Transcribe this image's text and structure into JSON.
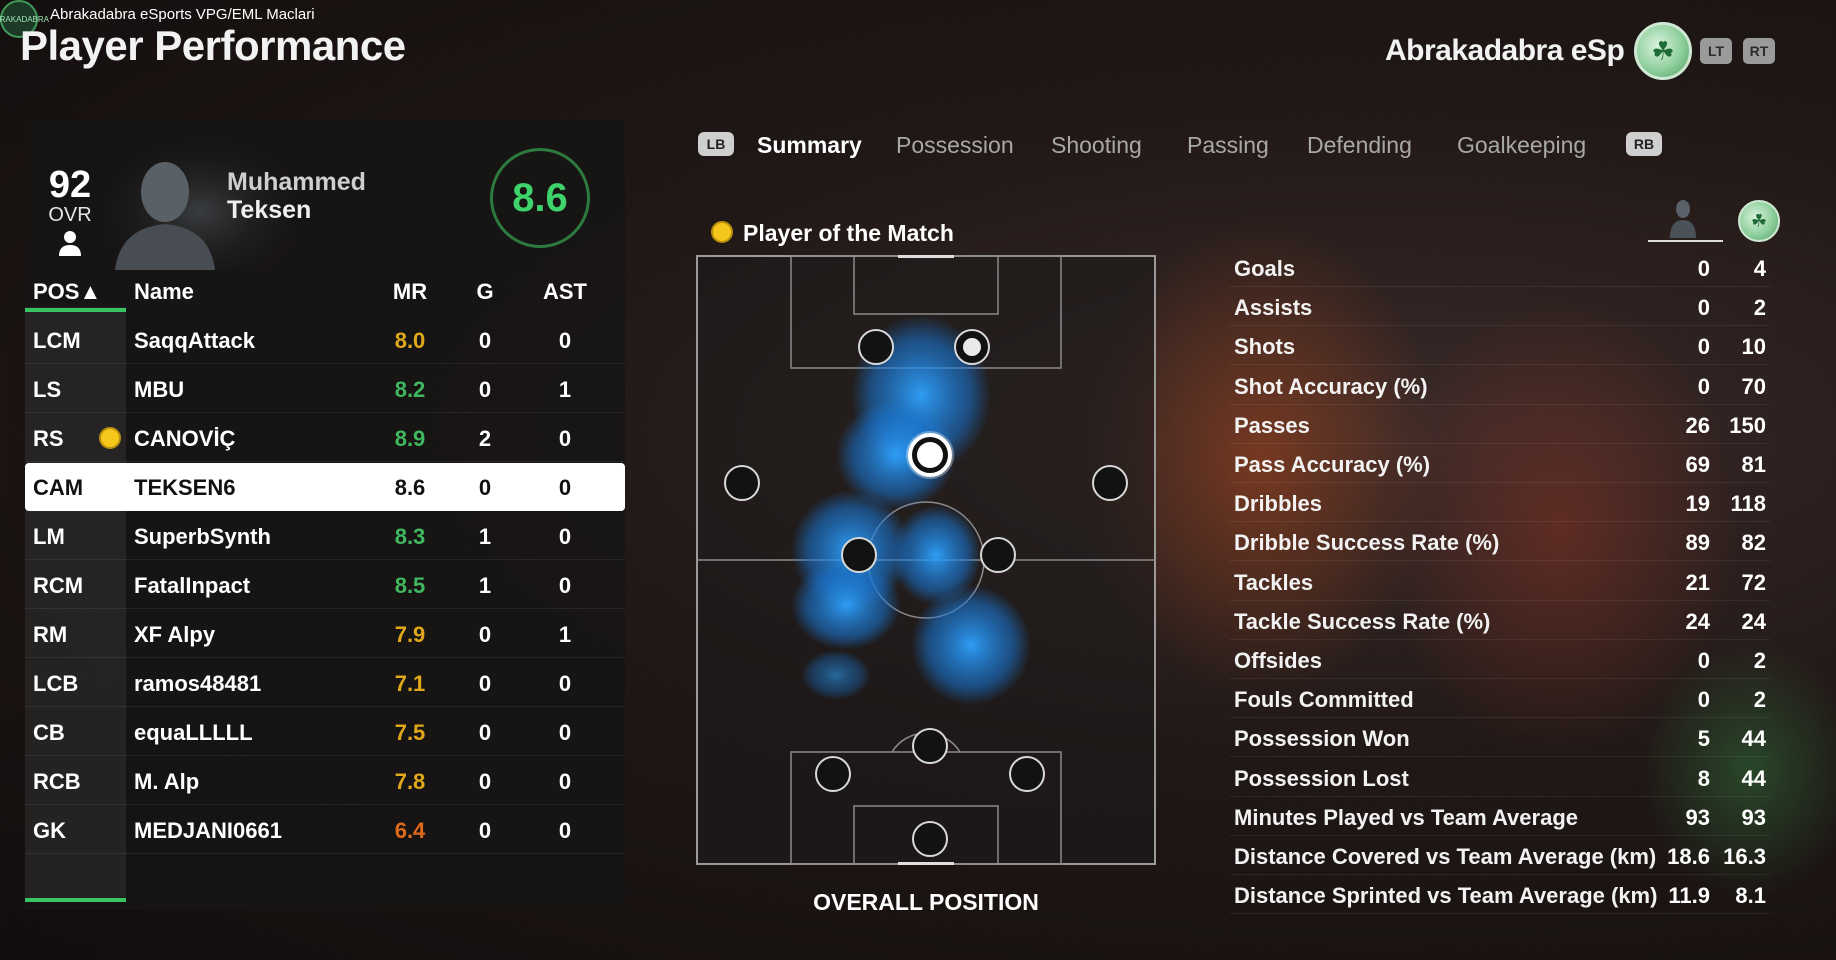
{
  "overlay": {
    "channel_title": "Abrakadabra eSports VPG/EML Maclari",
    "channel_logo_text": "ABRAKADABRA"
  },
  "page_title": "Player Performance",
  "team": {
    "name": "Abrakadabra eSp",
    "crest_icon": "clover-crest-icon",
    "lt": "LT",
    "rt": "RT"
  },
  "player_card": {
    "ovr": "92",
    "ovr_label": "OVR",
    "first_name": "Muhammed",
    "last_name": "Teksen",
    "rating": "8.6"
  },
  "table": {
    "headers": {
      "pos": "POS▲",
      "name": "Name",
      "mr": "MR",
      "g": "G",
      "ast": "AST"
    },
    "rows": [
      {
        "pos": "LCM",
        "name": "SaqqAttack",
        "mr": "8.0",
        "g": "0",
        "ast": "0",
        "mr_color": "#e0a81a",
        "potm": false,
        "selected": false
      },
      {
        "pos": "LS",
        "name": "MBU",
        "mr": "8.2",
        "g": "0",
        "ast": "1",
        "mr_color": "#3fb85f",
        "potm": false,
        "selected": false
      },
      {
        "pos": "RS",
        "name": "CANOVİÇ",
        "mr": "8.9",
        "g": "2",
        "ast": "0",
        "mr_color": "#3fb85f",
        "potm": true,
        "selected": false
      },
      {
        "pos": "CAM",
        "name": "TEKSEN6",
        "mr": "8.6",
        "g": "0",
        "ast": "0",
        "mr_color": "#111111",
        "potm": false,
        "selected": true
      },
      {
        "pos": "LM",
        "name": "SuperbSynth",
        "mr": "8.3",
        "g": "1",
        "ast": "0",
        "mr_color": "#3fb85f",
        "potm": false,
        "selected": false
      },
      {
        "pos": "RCM",
        "name": "FatalInpact",
        "mr": "8.5",
        "g": "1",
        "ast": "0",
        "mr_color": "#3fb85f",
        "potm": false,
        "selected": false
      },
      {
        "pos": "RM",
        "name": "XF Alpy",
        "mr": "7.9",
        "g": "0",
        "ast": "1",
        "mr_color": "#e0a81a",
        "potm": false,
        "selected": false
      },
      {
        "pos": "LCB",
        "name": "ramos48481",
        "mr": "7.1",
        "g": "0",
        "ast": "0",
        "mr_color": "#e0a81a",
        "potm": false,
        "selected": false
      },
      {
        "pos": "CB",
        "name": "equaLLLLL",
        "mr": "7.5",
        "g": "0",
        "ast": "0",
        "mr_color": "#e0a81a",
        "potm": false,
        "selected": false
      },
      {
        "pos": "RCB",
        "name": "M. Alp",
        "mr": "7.8",
        "g": "0",
        "ast": "0",
        "mr_color": "#e0a81a",
        "potm": false,
        "selected": false
      },
      {
        "pos": "GK",
        "name": "MEDJANI0661",
        "mr": "6.4",
        "g": "0",
        "ast": "0",
        "mr_color": "#e06a1a",
        "potm": false,
        "selected": false
      }
    ]
  },
  "tabs": {
    "lb": "LB",
    "rb": "RB",
    "items": [
      {
        "label": "Summary",
        "active": true
      },
      {
        "label": "Possession",
        "active": false
      },
      {
        "label": "Shooting",
        "active": false
      },
      {
        "label": "Passing",
        "active": false
      },
      {
        "label": "Defending",
        "active": false
      },
      {
        "label": "Goalkeeping",
        "active": false
      }
    ]
  },
  "pitch": {
    "potm_label": "Player of the Match",
    "caption": "OVERALL POSITION",
    "heat_color": "#1e90ff"
  },
  "stats": [
    {
      "label": "Goals",
      "player": "0",
      "team": "4"
    },
    {
      "label": "Assists",
      "player": "0",
      "team": "2"
    },
    {
      "label": "Shots",
      "player": "0",
      "team": "10"
    },
    {
      "label": "Shot Accuracy (%)",
      "player": "0",
      "team": "70"
    },
    {
      "label": "Passes",
      "player": "26",
      "team": "150"
    },
    {
      "label": "Pass Accuracy (%)",
      "player": "69",
      "team": "81"
    },
    {
      "label": "Dribbles",
      "player": "19",
      "team": "118"
    },
    {
      "label": "Dribble Success Rate (%)",
      "player": "89",
      "team": "82"
    },
    {
      "label": "Tackles",
      "player": "21",
      "team": "72"
    },
    {
      "label": "Tackle Success Rate (%)",
      "player": "24",
      "team": "24"
    },
    {
      "label": "Offsides",
      "player": "0",
      "team": "2"
    },
    {
      "label": "Fouls Committed",
      "player": "0",
      "team": "2"
    },
    {
      "label": "Possession Won",
      "player": "5",
      "team": "44"
    },
    {
      "label": "Possession Lost",
      "player": "8",
      "team": "44"
    },
    {
      "label": "Minutes Played vs Team Average",
      "player": "93",
      "team": "93"
    },
    {
      "label": "Distance Covered vs Team Average (km)",
      "player": "18.6",
      "team": "16.3"
    },
    {
      "label": "Distance Sprinted vs Team Average (km)",
      "player": "11.9",
      "team": "8.1"
    }
  ]
}
